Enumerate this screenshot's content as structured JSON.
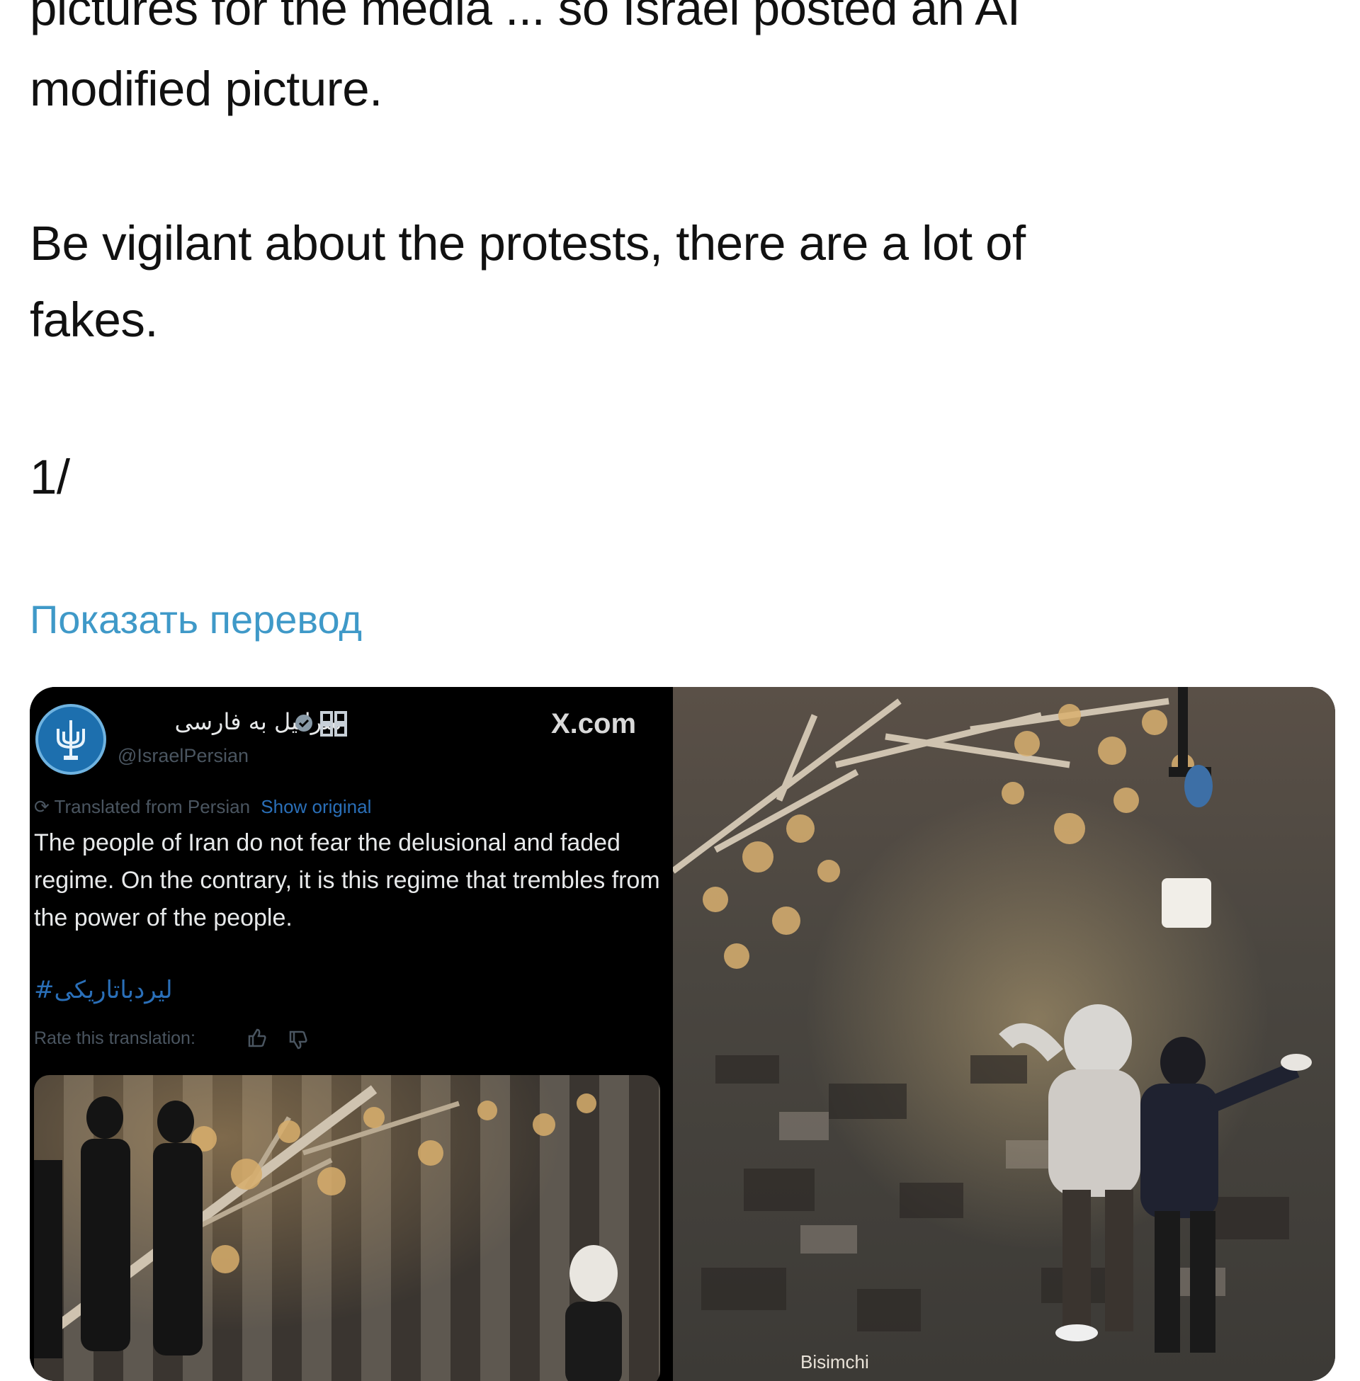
{
  "post": {
    "lines": [
      "pictures for the media ... so Israel posted an AI",
      "modified picture.",
      "Be vigilant about the protests, there are a lot of",
      "fakes.",
      "1/"
    ],
    "translate_link": "Показать перевод"
  },
  "embedded_tweet": {
    "display_name": "اسرائیل به فارسی",
    "handle": "@IsraelPersian",
    "source_site": "X.com",
    "translated_label": "Translated from Persian",
    "show_original_label": "Show original",
    "body": "The people of Iran do not fear the delusional and faded regime. On the contrary, it is this regime that trembles from the power of the people.",
    "hashtag": "#لیردباتاریکی",
    "rate_label": "Rate this translation:",
    "link_color": "#2a6fb8"
  },
  "photo": {
    "caption": "Bisimchi"
  },
  "colors": {
    "translate_link": "#3f99c8",
    "embed_background": "#000000"
  }
}
